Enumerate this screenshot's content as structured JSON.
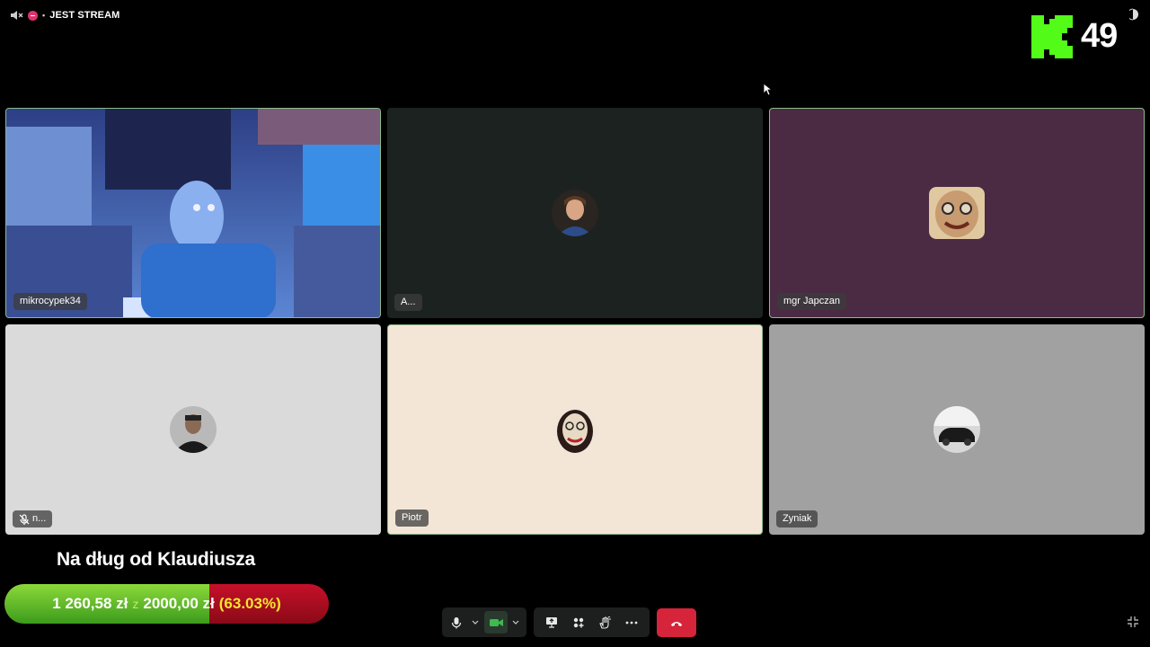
{
  "status": {
    "label": "JEST STREAM",
    "separator": "•"
  },
  "viewer_count": "49",
  "colors": {
    "kick_green": "#53fc18",
    "active_border": "#8dba8d",
    "end_call": "#d6243a",
    "goal_fill": "#53c21f",
    "goal_remaining": "#c6102a",
    "goal_percent": "#f6e62e"
  },
  "participants": [
    {
      "name": "mikrocypek34",
      "video": true,
      "bg": "#3550a8"
    },
    {
      "name": "A...",
      "video": false,
      "bg": "#1c2220"
    },
    {
      "name": "mgr Japczan",
      "video": false,
      "bg": "#4a2b43"
    },
    {
      "name": "n...",
      "video": false,
      "bg": "#dadada",
      "icon": "mic-muted-icon"
    },
    {
      "name": "Piotr",
      "video": false,
      "bg": "#f4e6d7"
    },
    {
      "name": "Zyniak",
      "video": false,
      "bg": "#a1a1a1"
    }
  ],
  "goal": {
    "title": "Na dług od Klaudiusza",
    "current": "1 260,58 zł",
    "separator": "z",
    "target": "2000,00 zł",
    "percent_label": "(63.03%)",
    "fraction": 0.6303
  },
  "controls": {
    "mic": "mic-icon",
    "camera": "camera-icon",
    "share": "present-screen-icon",
    "apps": "apps-icon",
    "reactions": "raise-hand-icon",
    "more": "more-options-icon",
    "end": "end-call-icon"
  }
}
